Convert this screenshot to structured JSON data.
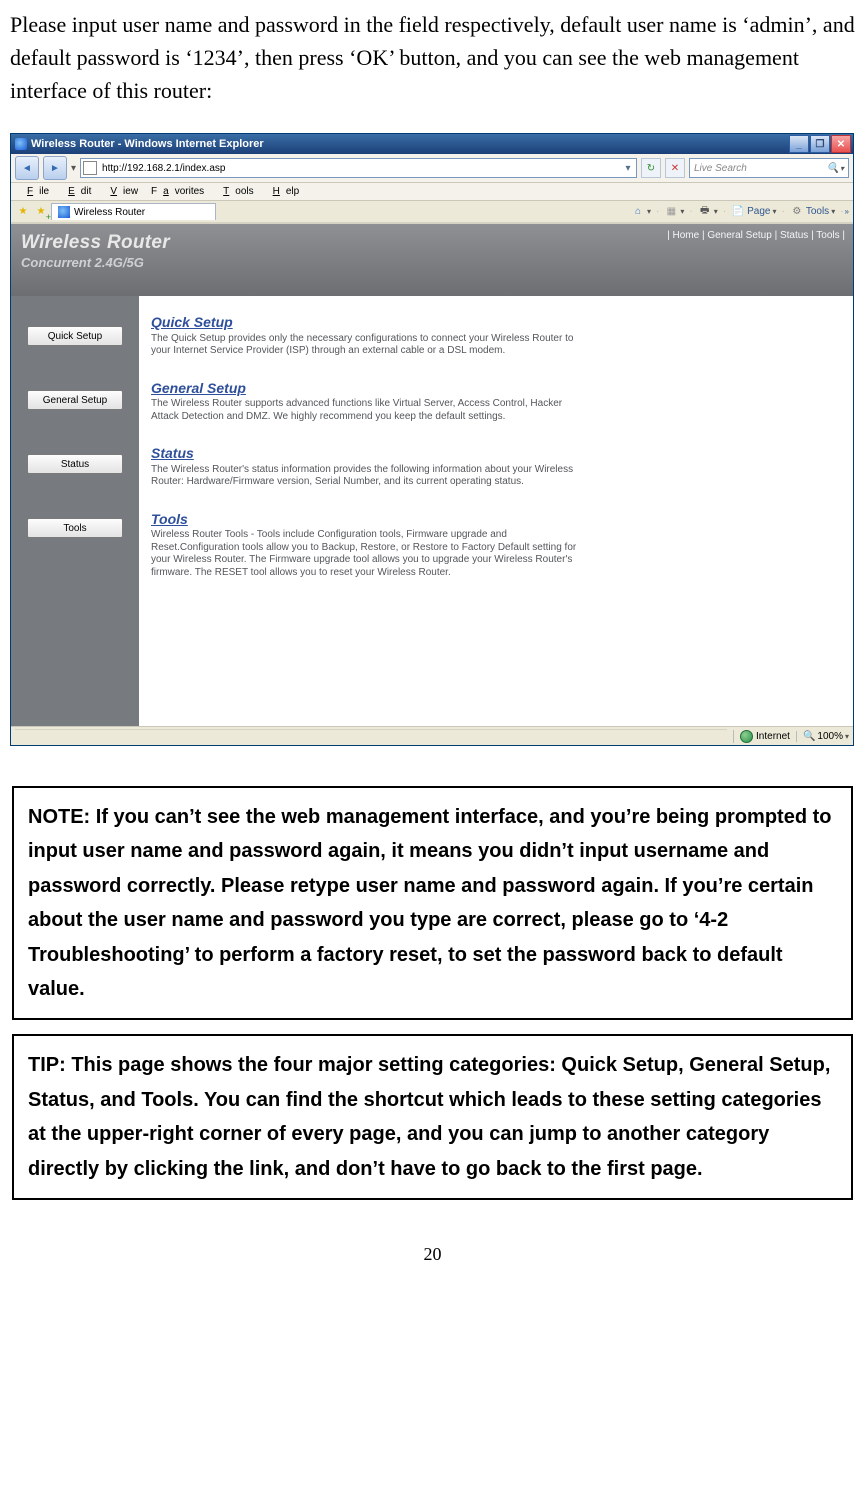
{
  "intro_text": "Please input user name and password in the field respectively, default user name is ‘admin’, and default password is ‘1234’, then press ‘OK’ button, and you can see the web management interface of this router:",
  "ie": {
    "title": "Wireless Router - Windows Internet Explorer",
    "url": "http://192.168.2.1/index.asp",
    "search_placeholder": "Live Search",
    "menu": {
      "file": "File",
      "edit": "Edit",
      "view": "View",
      "favorites": "Favorites",
      "tools": "Tools",
      "help": "Help"
    },
    "tab_label": "Wireless Router",
    "toolbar": {
      "page": "Page",
      "tools": "Tools"
    },
    "status": {
      "zone": "Internet",
      "zoom": "100%"
    }
  },
  "router": {
    "header_title": "Wireless Router",
    "header_sub": "Concurrent 2.4G/5G",
    "top_links": "| Home | General Setup | Status | Tools |",
    "sidebar": {
      "quick_setup": "Quick Setup",
      "general_setup": "General Setup",
      "status": "Status",
      "tools": "Tools"
    },
    "sections": {
      "quick_setup": {
        "title": "Quick Setup",
        "desc": "The Quick Setup provides only the necessary configurations to connect your Wireless Router to your Internet Service Provider (ISP) through an external cable or a DSL modem."
      },
      "general_setup": {
        "title": "General Setup",
        "desc": "The Wireless Router supports advanced functions like Virtual Server, Access Control, Hacker Attack Detection and DMZ. We highly recommend you keep the default settings."
      },
      "status": {
        "title": "Status",
        "desc": "The Wireless Router's status information provides the following information about your Wireless Router: Hardware/Firmware version, Serial Number, and its current operating status."
      },
      "tools": {
        "title": "Tools",
        "desc": "Wireless Router Tools - Tools include Configuration tools, Firmware upgrade and Reset.Configuration tools allow you to Backup, Restore, or Restore to Factory Default setting for your Wireless Router. The Firmware upgrade tool allows you to upgrade your Wireless Router's firmware. The RESET tool allows you to reset your Wireless Router."
      }
    }
  },
  "note_text": "NOTE: If you can’t see the web management interface, and you’re being prompted to input user name and password again, it means you didn’t input username and password correctly. Please retype user name and password again. If you’re certain about the user name and password you type are correct, please go to ‘4-2 Troubleshooting’ to perform a factory reset, to set the password back to default value.",
  "tip_text": "TIP: This page shows the four major setting categories: Quick Setup, General Setup, Status, and Tools. You can find the shortcut which leads to these setting categories at the upper-right corner of every page, and you can jump to another category directly by clicking the link, and don’t have to go back to the first page.",
  "page_number": "20"
}
